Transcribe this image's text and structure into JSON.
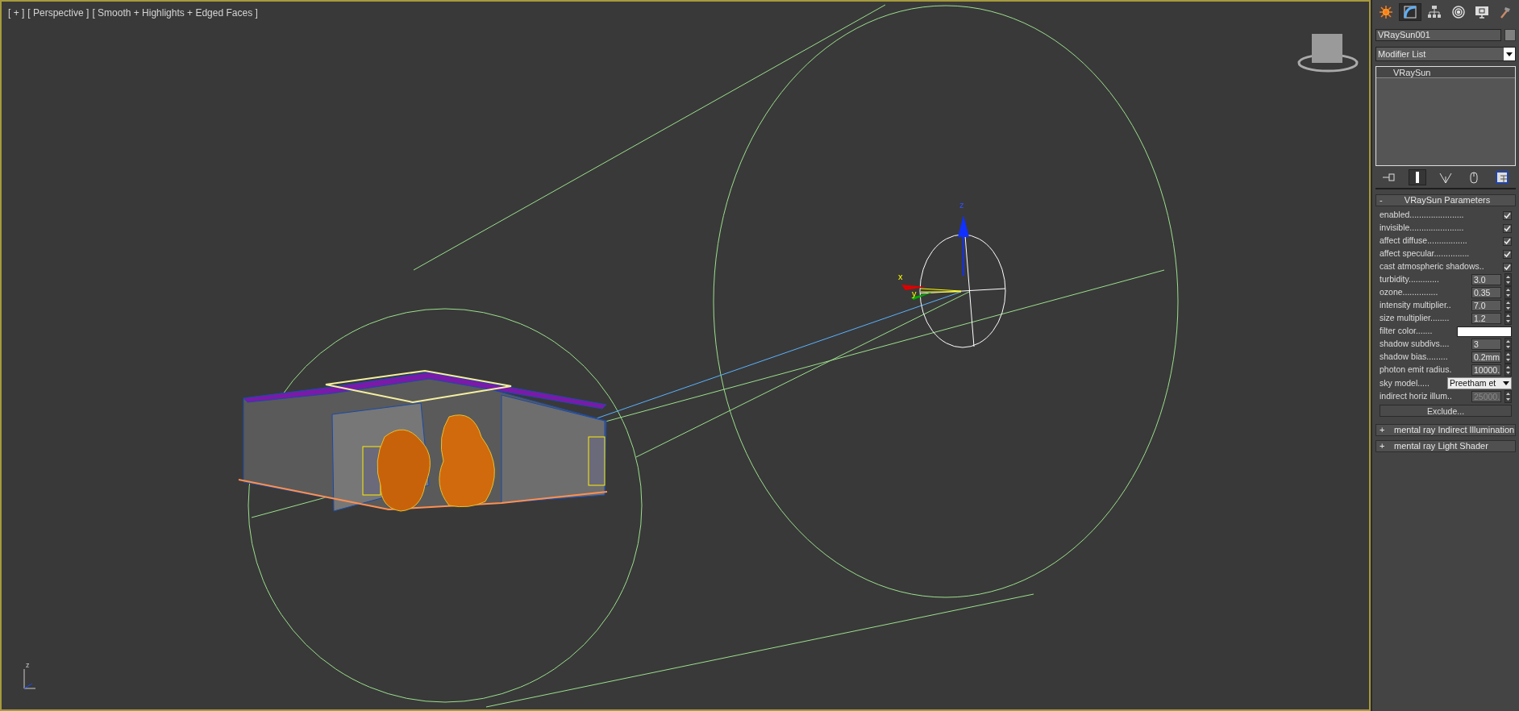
{
  "viewport": {
    "label_parts": [
      "[ + ]",
      "[ Perspective ]",
      "[ Smooth + Highlights + Edged Faces ]"
    ],
    "gizmo_axes": [
      {
        "label": "z"
      },
      {
        "label": "x"
      },
      {
        "label": "y"
      }
    ],
    "corner_axis_label": "z"
  },
  "command_panel": {
    "tabs": [
      {
        "selected": false
      },
      {
        "selected": true
      },
      {
        "selected": false
      },
      {
        "selected": false
      },
      {
        "selected": false
      },
      {
        "selected": false
      }
    ],
    "object_name": "VRaySun001",
    "modifier_list": "Modifier List",
    "modifier_stack": [
      {
        "label": "VRaySun",
        "selected": true
      }
    ],
    "stack_tools": [
      {
        "selected": false
      },
      {
        "selected": true
      },
      {
        "selected": false
      },
      {
        "selected": false
      },
      {
        "selected": false
      }
    ],
    "rollouts": [
      {
        "sign": "-",
        "title": "VRaySun Parameters",
        "expanded": true,
        "params": [
          {
            "kind": "checkbox",
            "label": "enabled.......................",
            "checked": true
          },
          {
            "kind": "checkbox",
            "label": "invisible.......................",
            "checked": true
          },
          {
            "kind": "checkbox",
            "label": "affect diffuse.................",
            "checked": true
          },
          {
            "kind": "checkbox",
            "label": "affect specular...............",
            "checked": true
          },
          {
            "kind": "checkbox",
            "label": "cast atmospheric shadows..",
            "checked": true
          },
          {
            "kind": "spinner",
            "label": "turbidity.............",
            "value": "3.0",
            "disabled": false
          },
          {
            "kind": "spinner",
            "label": "ozone...............",
            "value": "0.35",
            "disabled": false
          },
          {
            "kind": "spinner",
            "label": "intensity multiplier..",
            "value": "7.0",
            "disabled": false
          },
          {
            "kind": "spinner",
            "label": "size multiplier........",
            "value": "1.2",
            "disabled": false
          },
          {
            "kind": "color",
            "label": "filter color.......",
            "color": "#ffffff"
          },
          {
            "kind": "spinner",
            "label": "shadow subdivs....",
            "value": "3",
            "disabled": false
          },
          {
            "kind": "spinner",
            "label": "shadow bias.........",
            "value": "0.2mm",
            "disabled": false
          },
          {
            "kind": "spinner",
            "label": "photon emit radius.",
            "value": "10000.",
            "disabled": false
          },
          {
            "kind": "dropdown",
            "label": "sky model.....",
            "value": "Preetham et"
          },
          {
            "kind": "spinner",
            "label": "indirect horiz illum..",
            "value": "25000.",
            "disabled": true
          },
          {
            "kind": "button",
            "label": "Exclude..."
          }
        ]
      },
      {
        "sign": "+",
        "title": "mental ray Indirect Illumination",
        "expanded": false
      },
      {
        "sign": "+",
        "title": "mental ray Light Shader",
        "expanded": false
      }
    ]
  }
}
